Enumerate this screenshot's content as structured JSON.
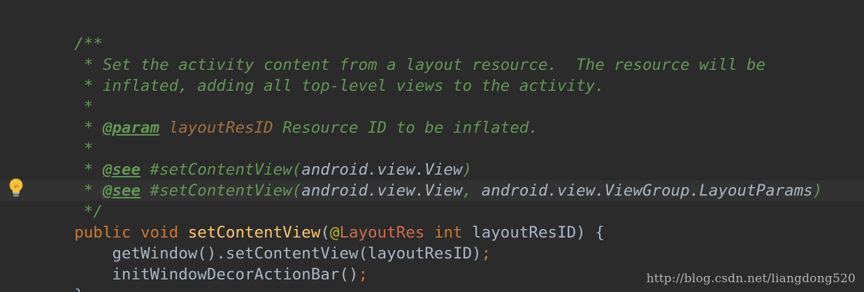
{
  "code": {
    "l1": "/**",
    "l2": " * Set the activity content from a layout resource.  The resource will be",
    "l3": " * inflated, adding all top-level views to the activity.",
    "l4": " *",
    "l5_prefix": " * ",
    "l5_tag": "@param",
    "l5_sp": " ",
    "l5_name": "layoutResID",
    "l5_rest": " Resource ID to be inflated.",
    "l6": " *",
    "l7_prefix": " * ",
    "l7_tag": "@see",
    "l7_a": " #setContentView(",
    "l7_b": "android.view.View",
    "l7_c": ")",
    "l8_prefix": " * ",
    "l8_tag": "@see",
    "l8_a": " #setContentView(",
    "l8_b": "android.view.View",
    "l8_c": ", ",
    "l8_d": "android.view.ViewGroup.LayoutParams",
    "l8_e": ")",
    "l9": " */",
    "l10_kw1": "public",
    "l10_sp1": " ",
    "l10_kw2": "void",
    "l10_sp2": " ",
    "l10_fn": "setContentView",
    "l10_p1": "(",
    "l10_at": "@",
    "l10_ann": "LayoutRes",
    "l10_sp3": " ",
    "l10_kw3": "int",
    "l10_rest": " layoutResID) {",
    "l11": "    getWindow().setContentView(layoutResID)",
    "l11_semi": ";",
    "l12": "    initWindowDecorActionBar()",
    "l12_semi": ";",
    "l13": "}"
  },
  "watermark": "http://blog.csdn.net/liangdong520",
  "icons": {
    "gutter": "lightbulb-icon"
  },
  "colors": {
    "background": "#2b2b2b",
    "doc_comment": "#629755",
    "keyword": "#cc7832",
    "function": "#ffc66d",
    "annotation": "#bbb529",
    "param_name": "#a26f3d"
  }
}
